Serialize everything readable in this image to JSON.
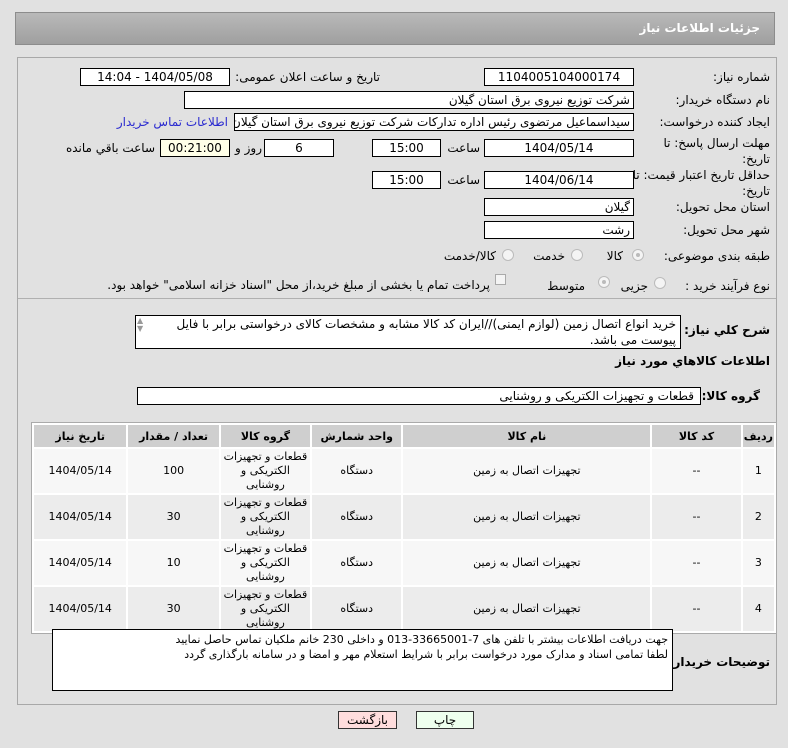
{
  "header": {
    "title": "جزئیات اطلاعات نیاز"
  },
  "form": {
    "need_number_label": "شماره نیاز:",
    "need_number": "1104005104000174",
    "announce_label": "تاریخ و ساعت اعلان عمومی:",
    "announce_value": "1404/05/08 - 14:04",
    "buyer_org_label": "نام دستگاه خریدار:",
    "buyer_org": "شرکت توزیع نیروی برق استان گیلان",
    "creator_label": "ایجاد کننده درخواست:",
    "creator": "سیداسماعیل مرتضوی رئیس اداره تدارکات شرکت توزیع نیروی برق استان گیلان",
    "contact_link": "اطلاعات تماس خریدار",
    "deadline_label": "مهلت ارسال پاسخ: تا تاریخ:",
    "deadline_date": "1404/05/14",
    "time_label": "ساعت",
    "deadline_time": "15:00",
    "days": "6",
    "days_label": "روز و",
    "remaining": "00:21:00",
    "remaining_label": "ساعت باقي مانده",
    "validity_label": "حداقل تاریخ اعتبار قیمت: تا تاریخ:",
    "validity_date": "1404/06/14",
    "validity_time": "15:00",
    "province_label": "استان محل تحویل:",
    "province": "گیلان",
    "city_label": "شهر محل تحویل:",
    "city": "رشت",
    "category_label": "طبقه بندی موضوعی:",
    "category_options": [
      "کالا",
      "خدمت",
      "کالا/خدمت"
    ],
    "process_label": "نوع فرآیند خرید :",
    "process_options": [
      "جزیی",
      "متوسط"
    ],
    "payment_note": "پرداخت تمام یا بخشی از مبلغ خرید،از محل \"اسناد خزانه اسلامی\" خواهد بود.",
    "description_label": "شرح کلي نياز:",
    "description": "خرید انواع اتصال زمین (لوازم ایمنی)//ایران کد کالا مشابه و مشخصات کالای درخواستی برابر با فایل پیوست می باشد.",
    "goods_heading": "اطلاعات کالاهاي مورد نياز",
    "goods_group_label": "گروه کالا:",
    "goods_group": "قطعات و تجهیزات الکتریکی و روشنایی"
  },
  "table": {
    "headers": [
      "ردیف",
      "کد کالا",
      "نام کالا",
      "واحد شمارش",
      "گروه کالا",
      "تعداد / مقدار",
      "تاریخ نیاز"
    ],
    "rows": [
      [
        "1",
        "--",
        "تجهیزات اتصال به زمین",
        "دستگاه",
        "قطعات و تجهیزات الکتریکی و روشنایی",
        "100",
        "1404/05/14"
      ],
      [
        "2",
        "--",
        "تجهیزات اتصال به زمین",
        "دستگاه",
        "قطعات و تجهیزات الکتریکی و روشنایی",
        "30",
        "1404/05/14"
      ],
      [
        "3",
        "--",
        "تجهیزات اتصال به زمین",
        "دستگاه",
        "قطعات و تجهیزات الکتریکی و روشنایی",
        "10",
        "1404/05/14"
      ],
      [
        "4",
        "--",
        "تجهیزات اتصال به زمین",
        "دستگاه",
        "قطعات و تجهیزات الکتریکی و روشنایی",
        "30",
        "1404/05/14"
      ]
    ]
  },
  "notes": {
    "label": "توضیحات خریدار:",
    "line1": "جهت دریافت اطلاعات بیشتر با تلفن های 7-33665001-013 و داخلی 230 خانم ملکیان تماس حاصل نمایید",
    "line2": "لطفا تمامی اسناد و مدارک مورد درخواست برابر با شرایط استعلام مهر و امضا و در سامانه بارگذاری گردد"
  },
  "buttons": {
    "print": "چاپ",
    "back": "بازگشت"
  }
}
